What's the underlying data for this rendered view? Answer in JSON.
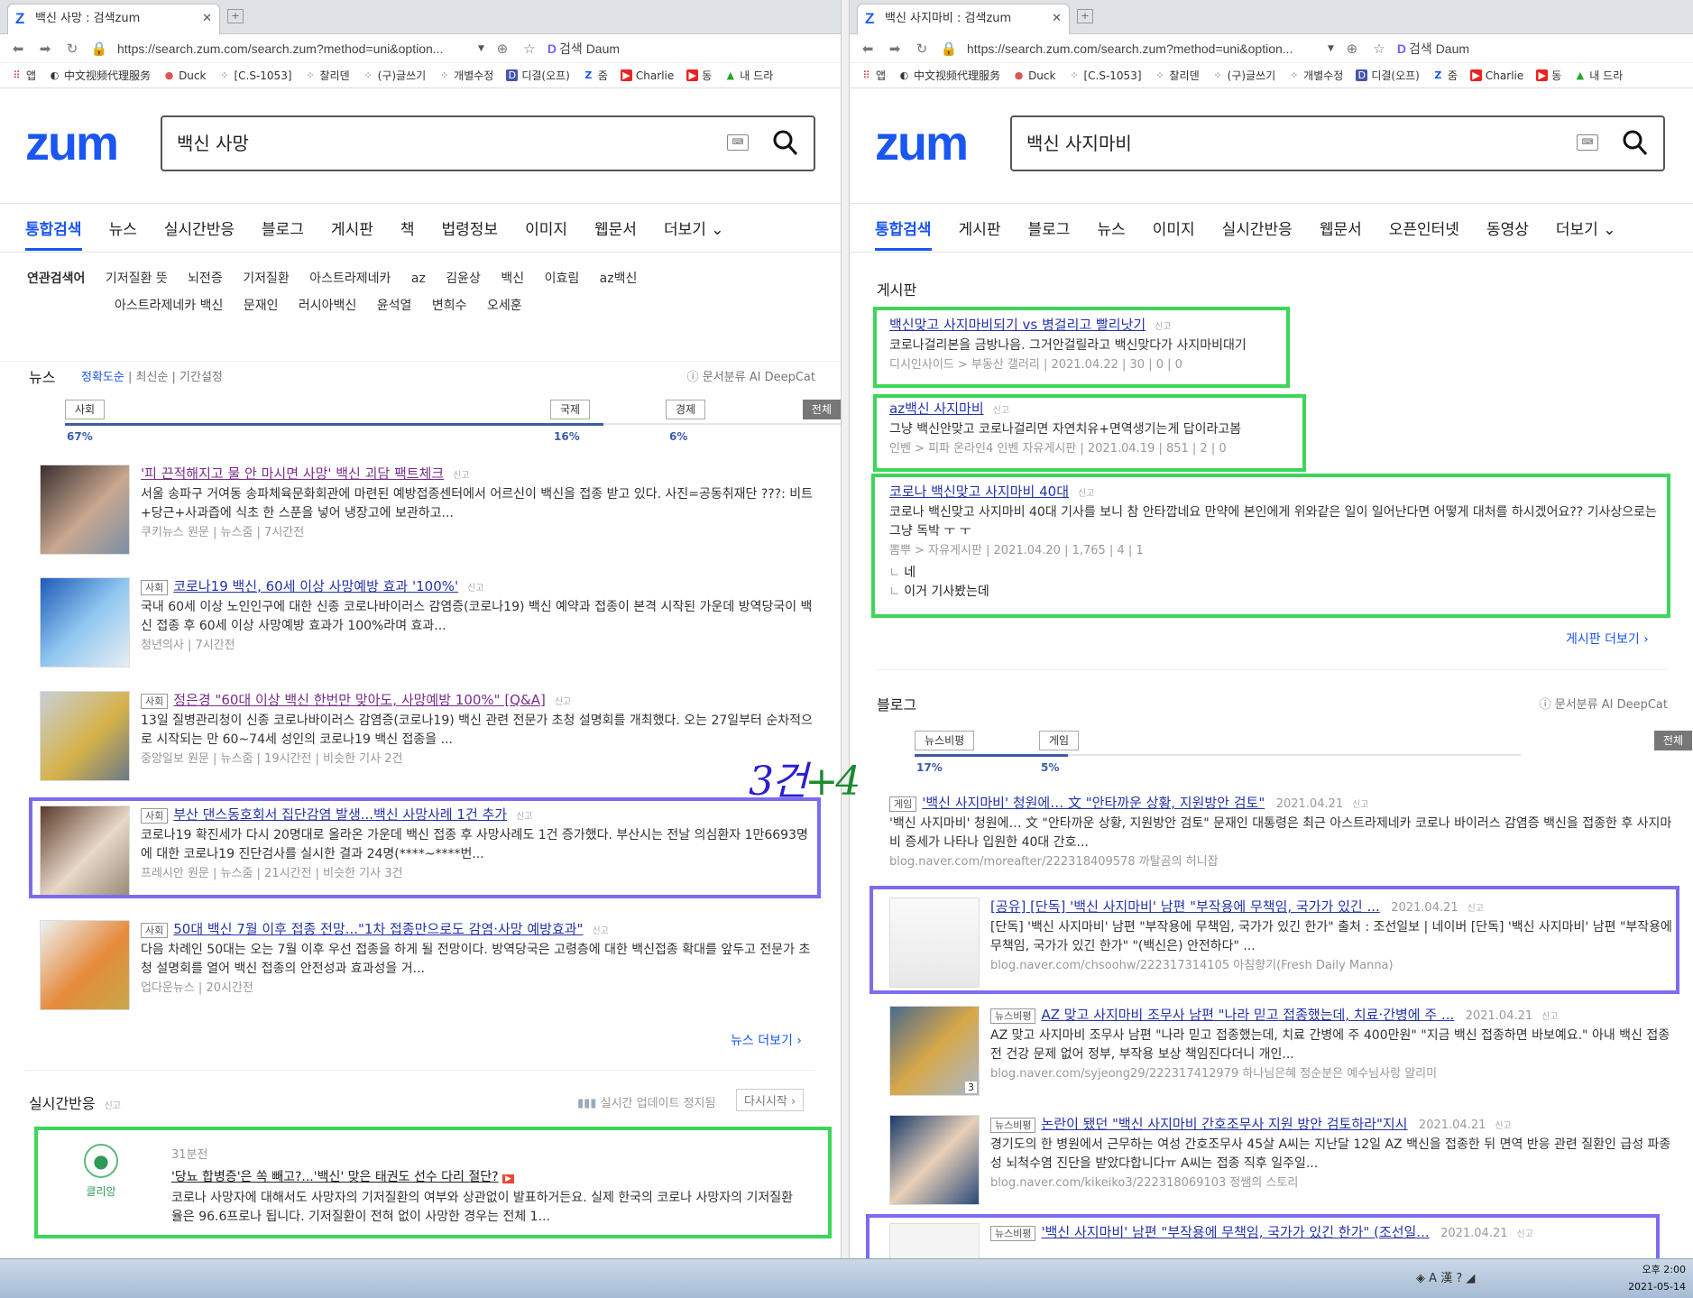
{
  "left": {
    "tab_title": "백신 사망 : 검색zum",
    "tab_favicon": "Z",
    "url": "https://search.zum.com/search.zum?method=uni&option...",
    "daum_label": "검색 Daum",
    "bookmarks": [
      "앱",
      "中文视频代理服务",
      "Duck",
      "[C.S-1053]",
      "찰리덴",
      "(구)글쓰기",
      "개별수정",
      "디결(오프)",
      "줌",
      "Charlie",
      "동",
      "내 드라"
    ],
    "logo": "zum",
    "query": "백신 사망",
    "menu": [
      "통합검색",
      "뉴스",
      "실시간반응",
      "블로그",
      "게시판",
      "책",
      "법령정보",
      "이미지",
      "웹문서",
      "더보기"
    ],
    "related_label": "연관검색어",
    "related_1": [
      "기저질환 뜻",
      "뇌전증",
      "기저질환",
      "아스트라제네카",
      "az",
      "김윤상",
      "백신",
      "이효림",
      "az백신"
    ],
    "related_2": [
      "아스트라제네카 백신",
      "문재인",
      "러시아백신",
      "윤석열",
      "변희수",
      "오세훈"
    ],
    "news_title": "뉴스",
    "news_sort": [
      "정확도순",
      "최신순",
      "기간설정"
    ],
    "deepcat": "문서분류 AI DeepCat",
    "categories": [
      {
        "name": "사회",
        "pct": "67%",
        "value": 67
      },
      {
        "name": "국제",
        "pct": "16%",
        "value": 16
      },
      {
        "name": "경제",
        "pct": "6%",
        "value": 6
      }
    ],
    "cat_all": "전체",
    "news": [
      {
        "tag": "",
        "title": "'피 끈적해지고 물 안 마시면 사망' 백신 괴담 팩트체크",
        "report": "신고",
        "desc": "서울 송파구 거여동 송파체육문화회관에 마련된 예방접종센터에서 어르신이 백신을 접종 받고 있다. 사진=공동취재단 ???: 비트+당근+사과즙에 식초 한 스푼을 넣어 냉장고에 보관하고...",
        "meta": "쿠키뉴스 원문  |  뉴스줌  |  7시간전"
      },
      {
        "tag": "사회",
        "title": "코로나19 백신, 60세 이상 사망예방 효과 '100%'",
        "report": "신고",
        "desc": "국내 60세 이상 노인인구에 대한 신종 코로나바이러스 감염증(코로나19) 백신 예약과 접종이 본격 시작된 가운데 방역당국이 백신 접종 후 60세 이상 사망예방 효과가 100%라며 효과...",
        "meta": "청년의사  |  7시간전"
      },
      {
        "tag": "사회",
        "title": "정은경 \"60대 이상 백신 한번만 맞아도, 사망예방 100%\" [Q&A]",
        "report": "신고",
        "desc": "13일 질병관리청이 신종 코로나바이러스 감염증(코로나19) 백신 관련 전문가 초청 설명회를 개최했다. 오는 27일부터 순차적으로 시작되는 만 60~74세 성인의 코로나19 백신 접종을 ...",
        "meta": "중앙일보 원문  |  뉴스줌  |  19시간전  |  비슷한 기사 2건"
      },
      {
        "tag": "사회",
        "title": "부산 댄스동호회서 집단감염 발생...백신 사망사례 1건 추가",
        "report": "신고",
        "desc": "코로나19 확진세가 다시 20명대로 올라온 가운데 백신 접종 후 사망사례도 1건 증가했다. 부산시는 전날 의심환자 1만6693명에 대한 코로나19 진단검사를 실시한 결과 24명(****~****번...",
        "meta": "프레시안 원문  |  뉴스줌  |  21시간전  |  비슷한 기사 3건"
      },
      {
        "tag": "사회",
        "title": "50대 백신 7월 이후 접종 전망...\"1차 접종만으로도 감염·사망 예방효과\"",
        "report": "신고",
        "desc": "다음 차례인 50대는 오는 7월 이후 우선 접종을 하게 될 전망이다. 방역당국은 고령층에 대한 백신접종 확대를 앞두고 전문가 초청 설명회를 열어 백신 접종의 안전성과 효과성을 거...",
        "meta": "업다운뉴스  |  20시간전"
      }
    ],
    "news_more": "뉴스 더보기 ›",
    "realtime_title": "실시간반응",
    "realtime_report": "신고",
    "realtime_status": "실시간 업데이트 정지됨",
    "realtime_restart": "다시시작",
    "realtime_user": "클리앙",
    "realtime_time": "31분전",
    "realtime_post_title": "'당뇨 합병증'은 쏙 빼고?...'백신' 맞은 태권도 선수 다리 절단?",
    "realtime_post_desc": "코로나 사망자에 대해서도 사망자의 기저질환의 여부와 상관없이 발표하거든요. 실제 한국의 코로나 사망자의 기저질환율은 96.6프로나 됩니다. 기저질환이 전혀 없이 사망한 경우는 전체 1..."
  },
  "right": {
    "tab_title": "백신 사지마비 : 검색zum",
    "tab_favicon": "Z",
    "url": "https://search.zum.com/search.zum?method=uni&option...",
    "daum_label": "검색 Daum",
    "bookmarks": [
      "앱",
      "中文视频代理服务",
      "Duck",
      "[C.S-1053]",
      "찰리덴",
      "(구)글쓰기",
      "개별수정",
      "디결(오프)",
      "줌",
      "Charlie",
      "동",
      "내 드라"
    ],
    "logo": "zum",
    "query": "백신 사지마비",
    "menu": [
      "통합검색",
      "게시판",
      "블로그",
      "뉴스",
      "이미지",
      "실시간반응",
      "웹문서",
      "오픈인터넷",
      "동영상",
      "더보기"
    ],
    "board_title": "게시판",
    "board": [
      {
        "title": "백신맞고 사지마비되기 vs 병걸리고 빨리낫기",
        "report": "신고",
        "desc": "코로나걸리본을 금방나음. 그거안걸릴라고 백신맞다가 사지마비대기",
        "meta": "디시인사이드 > 부동산 갤러리  |  2021.04.22  |  30  |  0  |  0",
        "reply1": "",
        "reply2": ""
      },
      {
        "title": "az백신 사지마비",
        "report": "신고",
        "desc": "그냥 백신안맞고 코로나걸리면 자연치유+면역생기는게 답이라고봄",
        "meta": "인벤 > 피파 온라인4 인벤 자유게시판  |  2021.04.19  |  851  |  2  |  0",
        "reply1": "",
        "reply2": ""
      },
      {
        "title": "코로나 백신맞고 사지마비 40대",
        "report": "신고",
        "desc": "코로나 백신맞고 사지마비 40대 기사를 보니 참 안타깝네요 만약에 본인에게 위와같은 일이 일어난다면 어떻게 대처를 하시겠어요?? 기사상으로는 그냥 독박 ㅜ ㅜ",
        "meta": "뽐뿌 > 자유게시판  |  2021.04.20  |  1,765  |  4  |  1",
        "reply1": "네",
        "reply2": "이거 기사봤는데"
      }
    ],
    "board_more": "게시판 더보기 ›",
    "blog_title": "블로그",
    "deepcat": "문서분류 AI DeepCat",
    "categories": [
      {
        "name": "뉴스비평",
        "pct": "17%",
        "value": 17
      },
      {
        "name": "게임",
        "pct": "5%",
        "value": 5
      }
    ],
    "cat_all": "전체",
    "blogs": [
      {
        "tag": "게임",
        "title": "'백신 사지마비' 청원에… 文 \"안타까운 상황, 지원방안 검토\"",
        "date": "2021.04.21",
        "report": "신고",
        "desc": "'백신 사지마비' 청원에… 文 \"안타까운 상황, 지원방안 검토\" 문재인 대통령은 최근 아스트라제네카 코로나 바이러스 감염증 백신을 접종한 후 사지마비 증세가 나타나 입원한 40대 간호...",
        "meta": "blog.naver.com/moreafter/222318409578   까탈곰의 허니잡"
      },
      {
        "tag": "",
        "title": "[공유] [단독] '백신 사지마비' 남편 \"부작용에 무책임, 국가가 있긴 ...",
        "date": "2021.04.21",
        "report": "신고",
        "desc": "[단독] '백신 사지마비' 남편 \"부작용에 무책임, 국가가 있긴 한가\" 출처 : 조선일보 | 네이버 [단독] '백신 사지마비' 남편 \"부작용에 무책임, 국가가 있긴 한가\" \"(백신은) 안전하다\" ...",
        "meta": "blog.naver.com/chsoohw/222317314105   아침향기(Fresh Daily Manna)"
      },
      {
        "tag": "뉴스비평",
        "title": "AZ 맞고 사지마비 조무사 남편 \"나라 믿고 접종했는데, 치료·간병에 주 ...",
        "date": "2021.04.21",
        "report": "신고",
        "desc": "AZ 맞고 사지마비 조무사 남편 \"나라 믿고 접종했는데, 치료 간병에 주 400만원\" \"지금 백신 접종하면 바보예요.\" 아내 백신 접종 전 건강 문제 없어 정부, 부작용 보상 책임진다더니 개인...",
        "meta": "blog.naver.com/syjeong29/222317412979   하나님은혜 정순분은 예수님사랑 알리미",
        "badge": "3"
      },
      {
        "tag": "뉴스비평",
        "title": "논란이 됐던 \"백신 사지마비 간호조무사 지원 방안 검토하라\"지시",
        "date": "2021.04.21",
        "report": "신고",
        "desc": "경기도의 한 병원에서 근무하는 여성 간호조무사 45살 A씨는 지난달 12일 AZ 백신을 접종한 뒤 면역 반응 관련 질환인 급성 파종성 뇌척수염 진단을 받았다합니다ㅠ A씨는 접종 직후 일주일...",
        "meta": "blog.naver.com/kikeiko3/222318069103   정쌤의 스토리"
      },
      {
        "tag": "뉴스비평",
        "title": "'백신 사지마비' 남편 \"부작용에 무책임, 국가가 있긴 한가\" (조선일...",
        "date": "2021.04.21",
        "report": "신고",
        "desc": "",
        "meta": ""
      }
    ]
  },
  "annotation": {
    "text": "3건",
    "plus": "+4"
  },
  "taskbar": {
    "time": "오후 2:00",
    "date": "2021-05-14"
  },
  "colors": {
    "zum_blue": "#1a56f2",
    "green_box": "#3dd65a",
    "purple_box": "#7b6cf0",
    "link": "#2433a8"
  }
}
